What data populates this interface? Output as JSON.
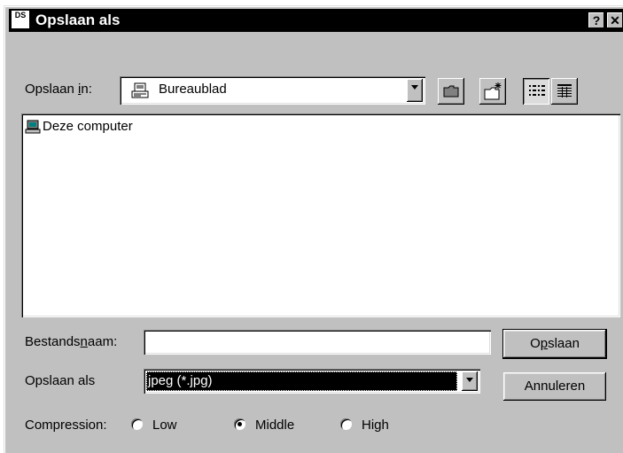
{
  "window": {
    "title": "Opslaan als",
    "icon": "ds-app-icon",
    "icon_text": "DS",
    "help_label": "?",
    "close_label": "✕"
  },
  "location": {
    "label_pre": "Opslaan ",
    "label_u": "i",
    "label_post": "n:",
    "value": "Bureaublad",
    "icon": "desktop-icon"
  },
  "toolbar": {
    "up_folder_icon": "folder-up-icon",
    "new_folder_icon": "new-folder-icon",
    "list_view_icon": "list-view-icon",
    "details_view_icon": "details-view-icon"
  },
  "file_list": {
    "items": [
      {
        "label": "Deze computer",
        "icon": "computer-icon"
      }
    ]
  },
  "filename": {
    "label_pre": "Bestands",
    "label_u": "n",
    "label_post": "aam:",
    "value": ""
  },
  "save_as": {
    "label": "Opslaan als",
    "value": "jpeg (*.jpg)"
  },
  "buttons": {
    "save_pre": "O",
    "save_u": "p",
    "save_post": "slaan",
    "cancel": "Annuleren"
  },
  "compression": {
    "label": "Compression:",
    "options": [
      {
        "label": "Low",
        "selected": false
      },
      {
        "label": "Middle",
        "selected": true
      },
      {
        "label": "High",
        "selected": false
      }
    ]
  },
  "colors": {
    "face": "#c0c0c0",
    "titlebar": "#000000",
    "selection": "#000000"
  }
}
